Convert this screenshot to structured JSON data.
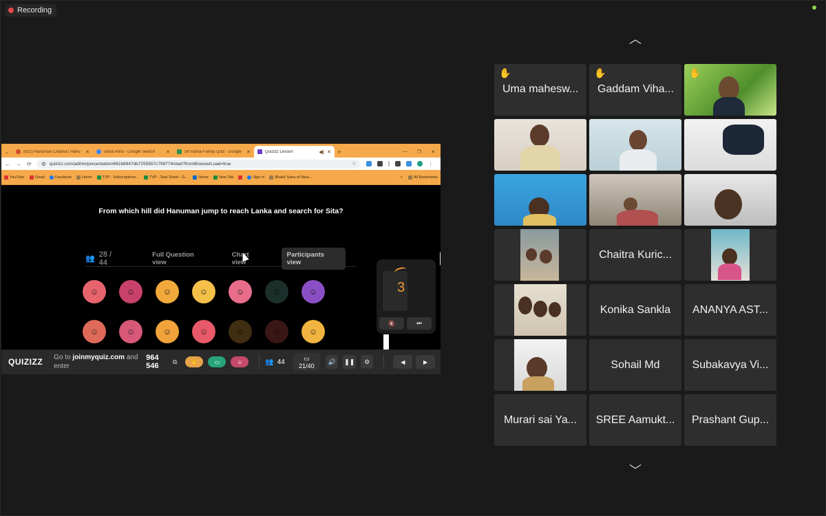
{
  "recording": {
    "label": "Recording"
  },
  "browser": {
    "tabs": [
      {
        "title": "(622) Hanuman Chalisa | Hanu",
        "icon": "youtube-icon",
        "active": false
      },
      {
        "title": "rama mitra - Google Search",
        "icon": "google-icon",
        "active": false
      },
      {
        "title": "Sri Rama Family Quiz - Google",
        "icon": "sheets-icon",
        "active": false
      },
      {
        "title": "Quizizz Lesson",
        "icon": "quizizz-icon",
        "active": true
      }
    ],
    "url": "quizizz.com/admin/presentation/661b6947db7255657c799774/start?fromBrowserLoad=true",
    "bookmarks": [
      "YouTube",
      "Gmail",
      "Facebook",
      "Home",
      "TVP - Subscriptions...",
      "TVP - Task Sheet - G...",
      "Home",
      "New Tab",
      "Sign In",
      "Bhakti Sutra of Nara..."
    ],
    "all_bookmarks": "All Bookmarks"
  },
  "quiz": {
    "question": "From which hill did Hanuman jump to reach Lanka and search for Sita?",
    "responded": "28 / 44",
    "views": [
      "Full Question view",
      "Chart view",
      "Participants view"
    ],
    "active_view": "Participants view",
    "timer": "3",
    "logo": "QUIZIZZ",
    "join_prefix": "Go to",
    "join_site": "joinmyquiz.com",
    "join_suffix": "and enter",
    "code": "964 546",
    "participants": "44",
    "progress": "21/40",
    "colors": {
      "accent": "#f39c3a",
      "tabbar": "#f6a94a",
      "bar": "#2a2a2a"
    }
  },
  "gallery": {
    "up_icon": "chevron-up-icon",
    "down_icon": "chevron-down-icon",
    "tiles": [
      {
        "name": "Uma mahesw...",
        "hand": true,
        "video": false
      },
      {
        "name": "Gaddam Viha...",
        "hand": true,
        "video": false
      },
      {
        "name": "",
        "hand": true,
        "video": true
      },
      {
        "name": "",
        "hand": false,
        "video": true
      },
      {
        "name": "",
        "hand": false,
        "video": true,
        "speaking": true
      },
      {
        "name": "",
        "hand": false,
        "video": true
      },
      {
        "name": "",
        "hand": false,
        "video": true
      },
      {
        "name": "",
        "hand": false,
        "video": true
      },
      {
        "name": "",
        "hand": false,
        "video": true
      },
      {
        "name": "",
        "hand": false,
        "video": true
      },
      {
        "name": "Chaitra Kuric...",
        "hand": false,
        "video": false
      },
      {
        "name": "",
        "hand": false,
        "video": true
      },
      {
        "name": "",
        "hand": false,
        "video": true
      },
      {
        "name": "Konika Sankla",
        "hand": false,
        "video": false
      },
      {
        "name": "ANANYA AST...",
        "hand": false,
        "video": false
      },
      {
        "name": "",
        "hand": false,
        "video": true
      },
      {
        "name": "Sohail Md",
        "hand": false,
        "video": false
      },
      {
        "name": "Subakavya Vi...",
        "hand": false,
        "video": false
      },
      {
        "name": "Murari sai Ya...",
        "hand": false,
        "video": false
      },
      {
        "name": "SREE Aamukt...",
        "hand": false,
        "video": false
      },
      {
        "name": "Prashant Gup...",
        "hand": false,
        "video": false
      }
    ],
    "colors": {
      "tile": "#2e2e2e",
      "speaking_border": "#2ee06b",
      "hand": "#f2c21b"
    }
  }
}
